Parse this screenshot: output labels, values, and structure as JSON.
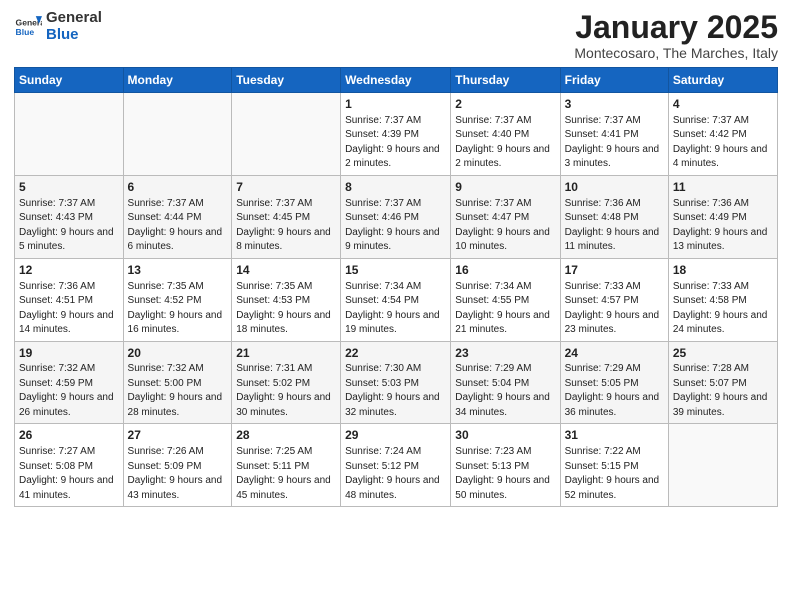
{
  "header": {
    "logo_general": "General",
    "logo_blue": "Blue",
    "month_title": "January 2025",
    "subtitle": "Montecosaro, The Marches, Italy"
  },
  "days_of_week": [
    "Sunday",
    "Monday",
    "Tuesday",
    "Wednesday",
    "Thursday",
    "Friday",
    "Saturday"
  ],
  "weeks": [
    [
      {
        "day": "",
        "info": ""
      },
      {
        "day": "",
        "info": ""
      },
      {
        "day": "",
        "info": ""
      },
      {
        "day": "1",
        "info": "Sunrise: 7:37 AM\nSunset: 4:39 PM\nDaylight: 9 hours and 2 minutes."
      },
      {
        "day": "2",
        "info": "Sunrise: 7:37 AM\nSunset: 4:40 PM\nDaylight: 9 hours and 2 minutes."
      },
      {
        "day": "3",
        "info": "Sunrise: 7:37 AM\nSunset: 4:41 PM\nDaylight: 9 hours and 3 minutes."
      },
      {
        "day": "4",
        "info": "Sunrise: 7:37 AM\nSunset: 4:42 PM\nDaylight: 9 hours and 4 minutes."
      }
    ],
    [
      {
        "day": "5",
        "info": "Sunrise: 7:37 AM\nSunset: 4:43 PM\nDaylight: 9 hours and 5 minutes."
      },
      {
        "day": "6",
        "info": "Sunrise: 7:37 AM\nSunset: 4:44 PM\nDaylight: 9 hours and 6 minutes."
      },
      {
        "day": "7",
        "info": "Sunrise: 7:37 AM\nSunset: 4:45 PM\nDaylight: 9 hours and 8 minutes."
      },
      {
        "day": "8",
        "info": "Sunrise: 7:37 AM\nSunset: 4:46 PM\nDaylight: 9 hours and 9 minutes."
      },
      {
        "day": "9",
        "info": "Sunrise: 7:37 AM\nSunset: 4:47 PM\nDaylight: 9 hours and 10 minutes."
      },
      {
        "day": "10",
        "info": "Sunrise: 7:36 AM\nSunset: 4:48 PM\nDaylight: 9 hours and 11 minutes."
      },
      {
        "day": "11",
        "info": "Sunrise: 7:36 AM\nSunset: 4:49 PM\nDaylight: 9 hours and 13 minutes."
      }
    ],
    [
      {
        "day": "12",
        "info": "Sunrise: 7:36 AM\nSunset: 4:51 PM\nDaylight: 9 hours and 14 minutes."
      },
      {
        "day": "13",
        "info": "Sunrise: 7:35 AM\nSunset: 4:52 PM\nDaylight: 9 hours and 16 minutes."
      },
      {
        "day": "14",
        "info": "Sunrise: 7:35 AM\nSunset: 4:53 PM\nDaylight: 9 hours and 18 minutes."
      },
      {
        "day": "15",
        "info": "Sunrise: 7:34 AM\nSunset: 4:54 PM\nDaylight: 9 hours and 19 minutes."
      },
      {
        "day": "16",
        "info": "Sunrise: 7:34 AM\nSunset: 4:55 PM\nDaylight: 9 hours and 21 minutes."
      },
      {
        "day": "17",
        "info": "Sunrise: 7:33 AM\nSunset: 4:57 PM\nDaylight: 9 hours and 23 minutes."
      },
      {
        "day": "18",
        "info": "Sunrise: 7:33 AM\nSunset: 4:58 PM\nDaylight: 9 hours and 24 minutes."
      }
    ],
    [
      {
        "day": "19",
        "info": "Sunrise: 7:32 AM\nSunset: 4:59 PM\nDaylight: 9 hours and 26 minutes."
      },
      {
        "day": "20",
        "info": "Sunrise: 7:32 AM\nSunset: 5:00 PM\nDaylight: 9 hours and 28 minutes."
      },
      {
        "day": "21",
        "info": "Sunrise: 7:31 AM\nSunset: 5:02 PM\nDaylight: 9 hours and 30 minutes."
      },
      {
        "day": "22",
        "info": "Sunrise: 7:30 AM\nSunset: 5:03 PM\nDaylight: 9 hours and 32 minutes."
      },
      {
        "day": "23",
        "info": "Sunrise: 7:29 AM\nSunset: 5:04 PM\nDaylight: 9 hours and 34 minutes."
      },
      {
        "day": "24",
        "info": "Sunrise: 7:29 AM\nSunset: 5:05 PM\nDaylight: 9 hours and 36 minutes."
      },
      {
        "day": "25",
        "info": "Sunrise: 7:28 AM\nSunset: 5:07 PM\nDaylight: 9 hours and 39 minutes."
      }
    ],
    [
      {
        "day": "26",
        "info": "Sunrise: 7:27 AM\nSunset: 5:08 PM\nDaylight: 9 hours and 41 minutes."
      },
      {
        "day": "27",
        "info": "Sunrise: 7:26 AM\nSunset: 5:09 PM\nDaylight: 9 hours and 43 minutes."
      },
      {
        "day": "28",
        "info": "Sunrise: 7:25 AM\nSunset: 5:11 PM\nDaylight: 9 hours and 45 minutes."
      },
      {
        "day": "29",
        "info": "Sunrise: 7:24 AM\nSunset: 5:12 PM\nDaylight: 9 hours and 48 minutes."
      },
      {
        "day": "30",
        "info": "Sunrise: 7:23 AM\nSunset: 5:13 PM\nDaylight: 9 hours and 50 minutes."
      },
      {
        "day": "31",
        "info": "Sunrise: 7:22 AM\nSunset: 5:15 PM\nDaylight: 9 hours and 52 minutes."
      },
      {
        "day": "",
        "info": ""
      }
    ]
  ]
}
